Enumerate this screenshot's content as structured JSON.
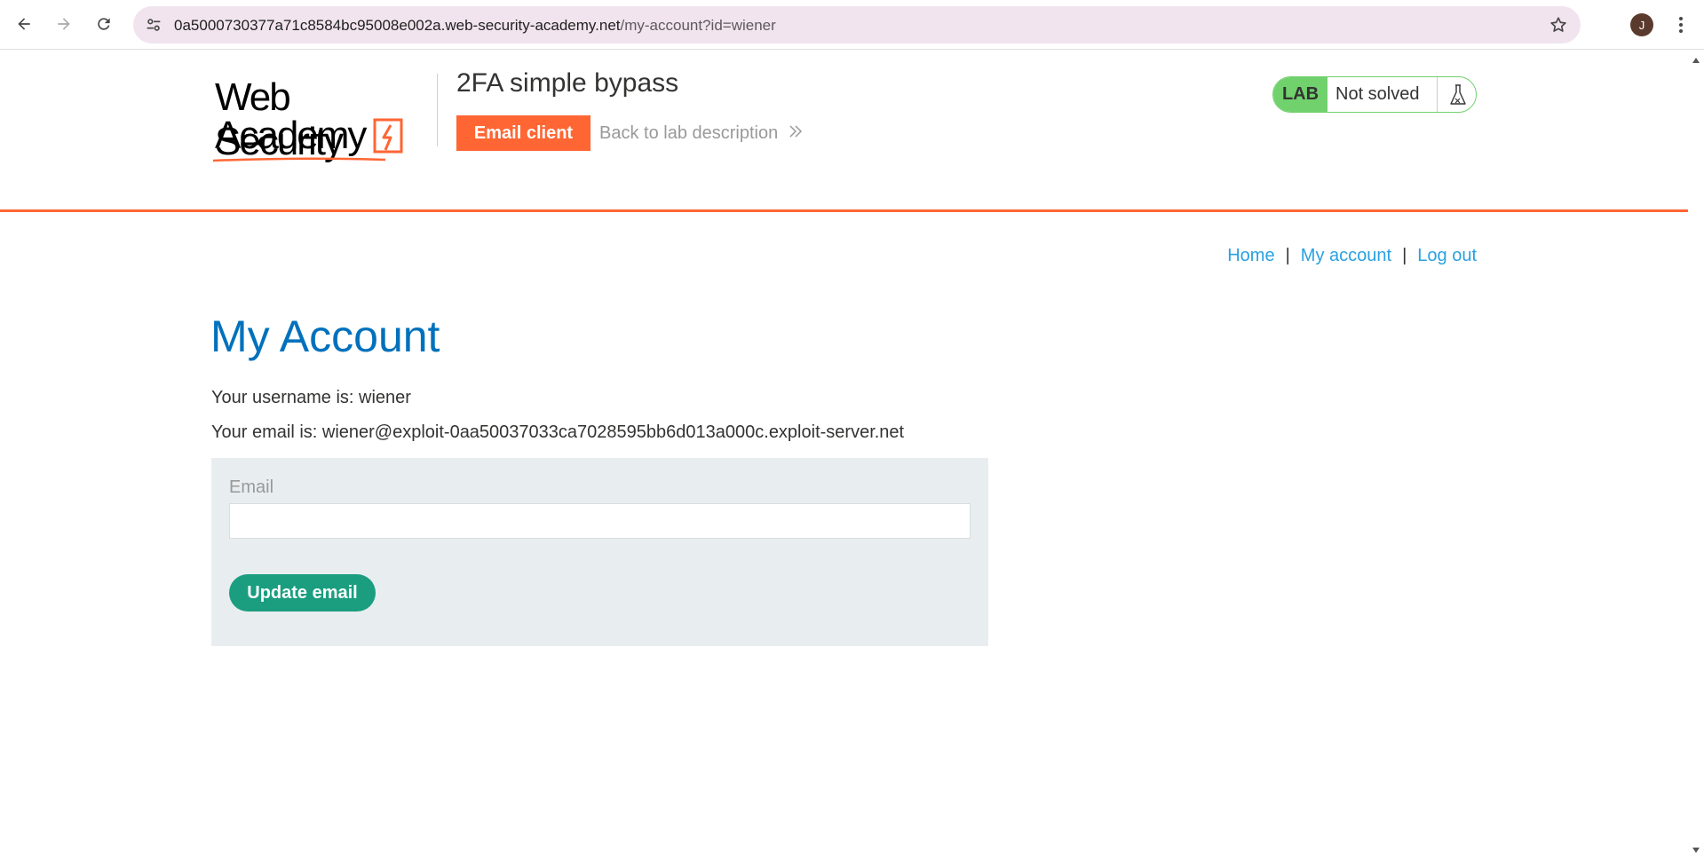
{
  "browser": {
    "url_host": "0a5000730377a71c8584bc95008e002a.web-security-academy.net",
    "url_path": "/my-account?id=wiener",
    "profile_initial": "J"
  },
  "header": {
    "logo_line1": "Web Security",
    "logo_line2": "Academy",
    "lab_title": "2FA simple bypass",
    "email_client_label": "Email client",
    "back_link_label": "Back to lab description",
    "lab_badge": "LAB",
    "lab_status": "Not solved"
  },
  "nav": {
    "home": "Home",
    "separator": "|",
    "my_account": "My account",
    "log_out": "Log out"
  },
  "main": {
    "title": "My Account",
    "username_line": "Your username is: wiener",
    "email_line": "Your email is: wiener@exploit-0aa50037033ca7028595bb6d013a000c.exploit-server.net",
    "form": {
      "email_label": "Email",
      "email_value": "",
      "submit_label": "Update email"
    }
  },
  "colors": {
    "accent_orange": "#ff6633",
    "heading_blue": "#0071bc",
    "link_blue": "#29a1e0",
    "lab_green": "#70d16d",
    "button_green": "#1a9e7f",
    "form_bg": "#e8eef0"
  },
  "icons": {
    "back": "arrow-left-icon",
    "forward": "arrow-right-icon",
    "reload": "reload-icon",
    "site_info": "tune-icon",
    "bookmark": "star-icon",
    "menu": "kebab-menu-icon",
    "lab_flask": "flask-icon"
  }
}
